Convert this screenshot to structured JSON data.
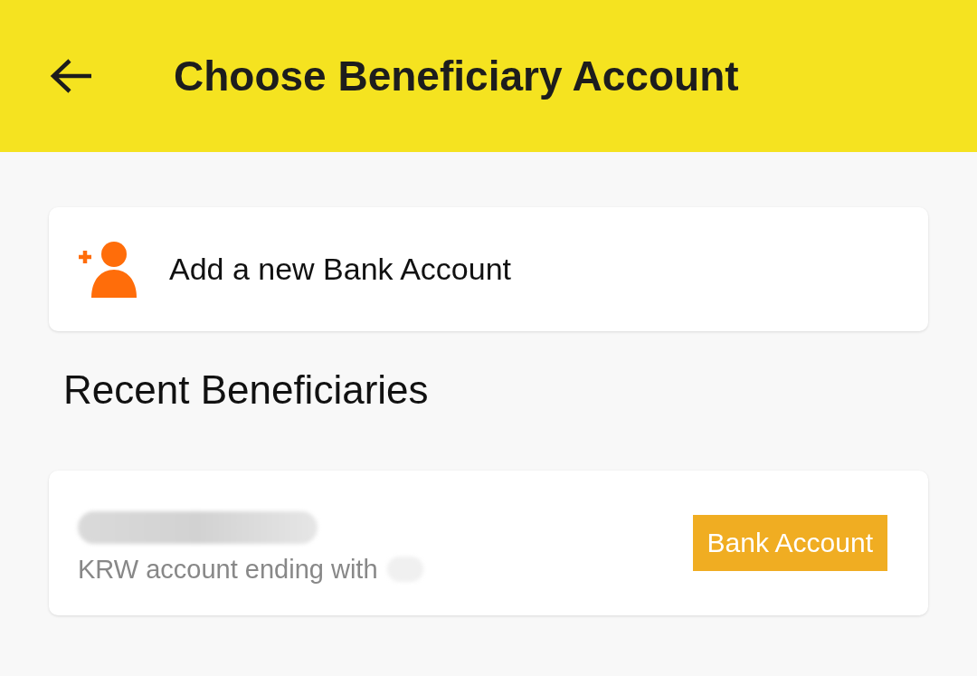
{
  "header": {
    "title": "Choose Beneficiary Account"
  },
  "add_account": {
    "label": "Add a new Bank Account"
  },
  "section_title": "Recent Beneficiaries",
  "beneficiaries": [
    {
      "detail": "KRW account ending with",
      "badge": "Bank Account"
    }
  ]
}
